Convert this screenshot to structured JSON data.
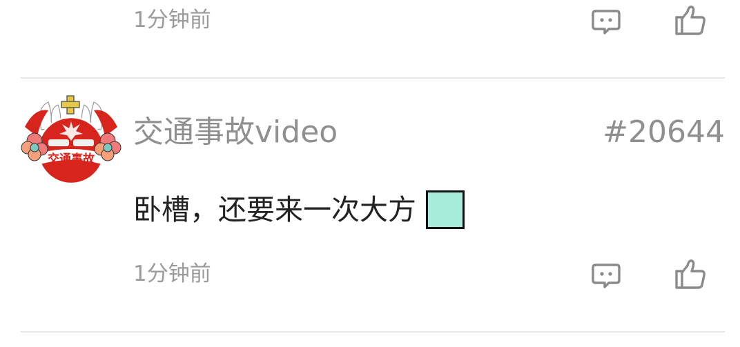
{
  "prev_comment": {
    "time": "1分钟前"
  },
  "comment": {
    "username": "交通事故video",
    "avatar_text": "交通事故",
    "floor": "#20644",
    "text": "卧槽，还要来一次大方",
    "emoji_color": "#a8eddb",
    "time": "1分钟前"
  },
  "icons": {
    "reply": "comment-bubble-icon",
    "like": "thumbs-up-icon"
  },
  "colors": {
    "meta_text": "#9a9a9a",
    "icon_stroke": "#8a8a8a",
    "divider": "#e8e8e8",
    "avatar_red": "#d7251d"
  }
}
